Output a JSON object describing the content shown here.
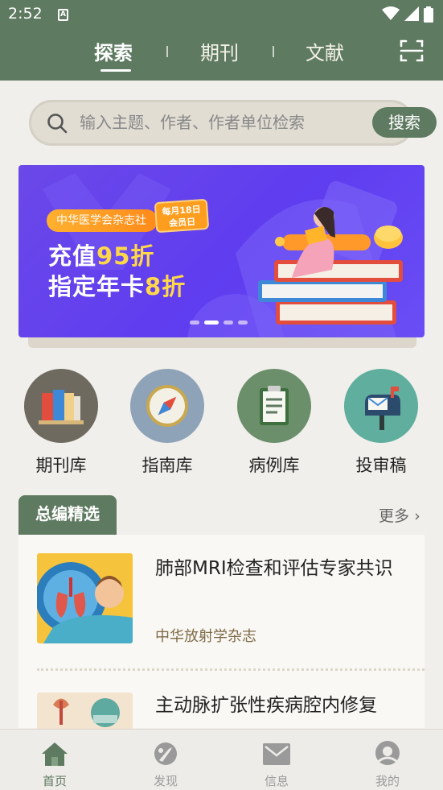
{
  "status_bar": {
    "time": "2:52",
    "sim_icon": "A"
  },
  "header": {
    "tabs": [
      {
        "label": "探索",
        "active": true
      },
      {
        "label": "期刊",
        "active": false
      },
      {
        "label": "文献",
        "active": false
      }
    ],
    "scan_icon": "scan-icon"
  },
  "search": {
    "placeholder": "输入主题、作者、作者单位检索",
    "button_label": "搜索"
  },
  "banner": {
    "publisher": "中华医学会杂志社",
    "date_badge_line1": "每月18日",
    "date_badge_line2": "会员日",
    "promo_line1_prefix": "充值",
    "promo_line1_highlight": "95折",
    "promo_line2_prefix": "指定年卡",
    "promo_line2_highlight": "8折",
    "slides": 4,
    "active_slide": 2
  },
  "quick_entries": [
    {
      "label": "期刊库",
      "icon": "books-icon",
      "color": "#6e6a60"
    },
    {
      "label": "指南库",
      "icon": "compass-icon",
      "color": "#8ea3b8"
    },
    {
      "label": "病例库",
      "icon": "clipboard-icon",
      "color": "#6a8f6a"
    },
    {
      "label": "投审稿",
      "icon": "mailbox-icon",
      "color": "#5fae9e"
    }
  ],
  "section": {
    "title": "总编精选",
    "more_label": "更多"
  },
  "articles": [
    {
      "title": "肺部MRI检查和评估专家共识",
      "journal": "中华放射学杂志"
    },
    {
      "title": "主动脉扩张性疾病腔内修复",
      "journal": ""
    }
  ],
  "bottom_nav": [
    {
      "label": "首页",
      "icon": "home-icon",
      "active": true
    },
    {
      "label": "发现",
      "icon": "discover-icon",
      "active": false
    },
    {
      "label": "信息",
      "icon": "message-icon",
      "active": false
    },
    {
      "label": "我的",
      "icon": "profile-icon",
      "active": false
    }
  ],
  "colors": {
    "brand": "#5e7a60",
    "background": "#f1efeb",
    "banner": "#6546ee",
    "accent": "#ffd84a"
  }
}
